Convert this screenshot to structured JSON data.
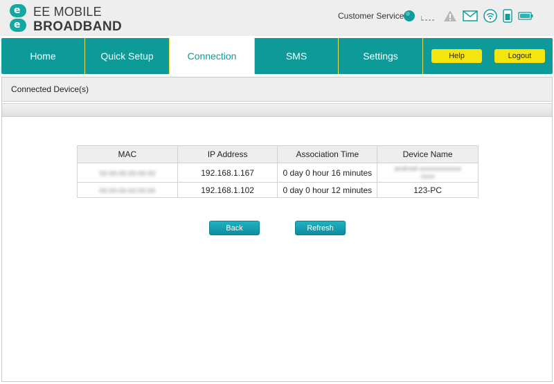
{
  "brand": {
    "line1": "EE MOBILE",
    "line2": "BROADBAND",
    "mark": [
      "e",
      "e"
    ],
    "color": "#14a8a0"
  },
  "header": {
    "customer_service": "Customer Service"
  },
  "status_icons": [
    "status-indicator-icon",
    "signal-strength-icon",
    "warning-icon",
    "mail-icon",
    "wifi-icon",
    "sim-card-icon",
    "battery-icon"
  ],
  "nav": {
    "tabs": [
      {
        "label": "Home"
      },
      {
        "label": "Quick Setup"
      },
      {
        "label": "Connection",
        "active": true
      },
      {
        "label": "SMS"
      },
      {
        "label": "Settings"
      }
    ],
    "help_label": "Help",
    "logout_label": "Logout",
    "accent": "#0e9a99",
    "button_color": "#f4e50f"
  },
  "page": {
    "title": "Connected Device(s)"
  },
  "table": {
    "columns": [
      "MAC",
      "IP Address",
      "Association Time",
      "Device Name"
    ],
    "rows": [
      {
        "mac": "00:00:00:00:00:00",
        "ip": "192.168.1.167",
        "time": "0 day 0 hour 16 minutes",
        "name": "android-xxxxxxxxxxxxxxxx"
      },
      {
        "mac": "00:00:00:00:00:00",
        "ip": "192.168.1.102",
        "time": "0 day 0 hour 12 minutes",
        "name": "123-PC"
      }
    ]
  },
  "buttons": {
    "back": "Back",
    "refresh": "Refresh"
  }
}
